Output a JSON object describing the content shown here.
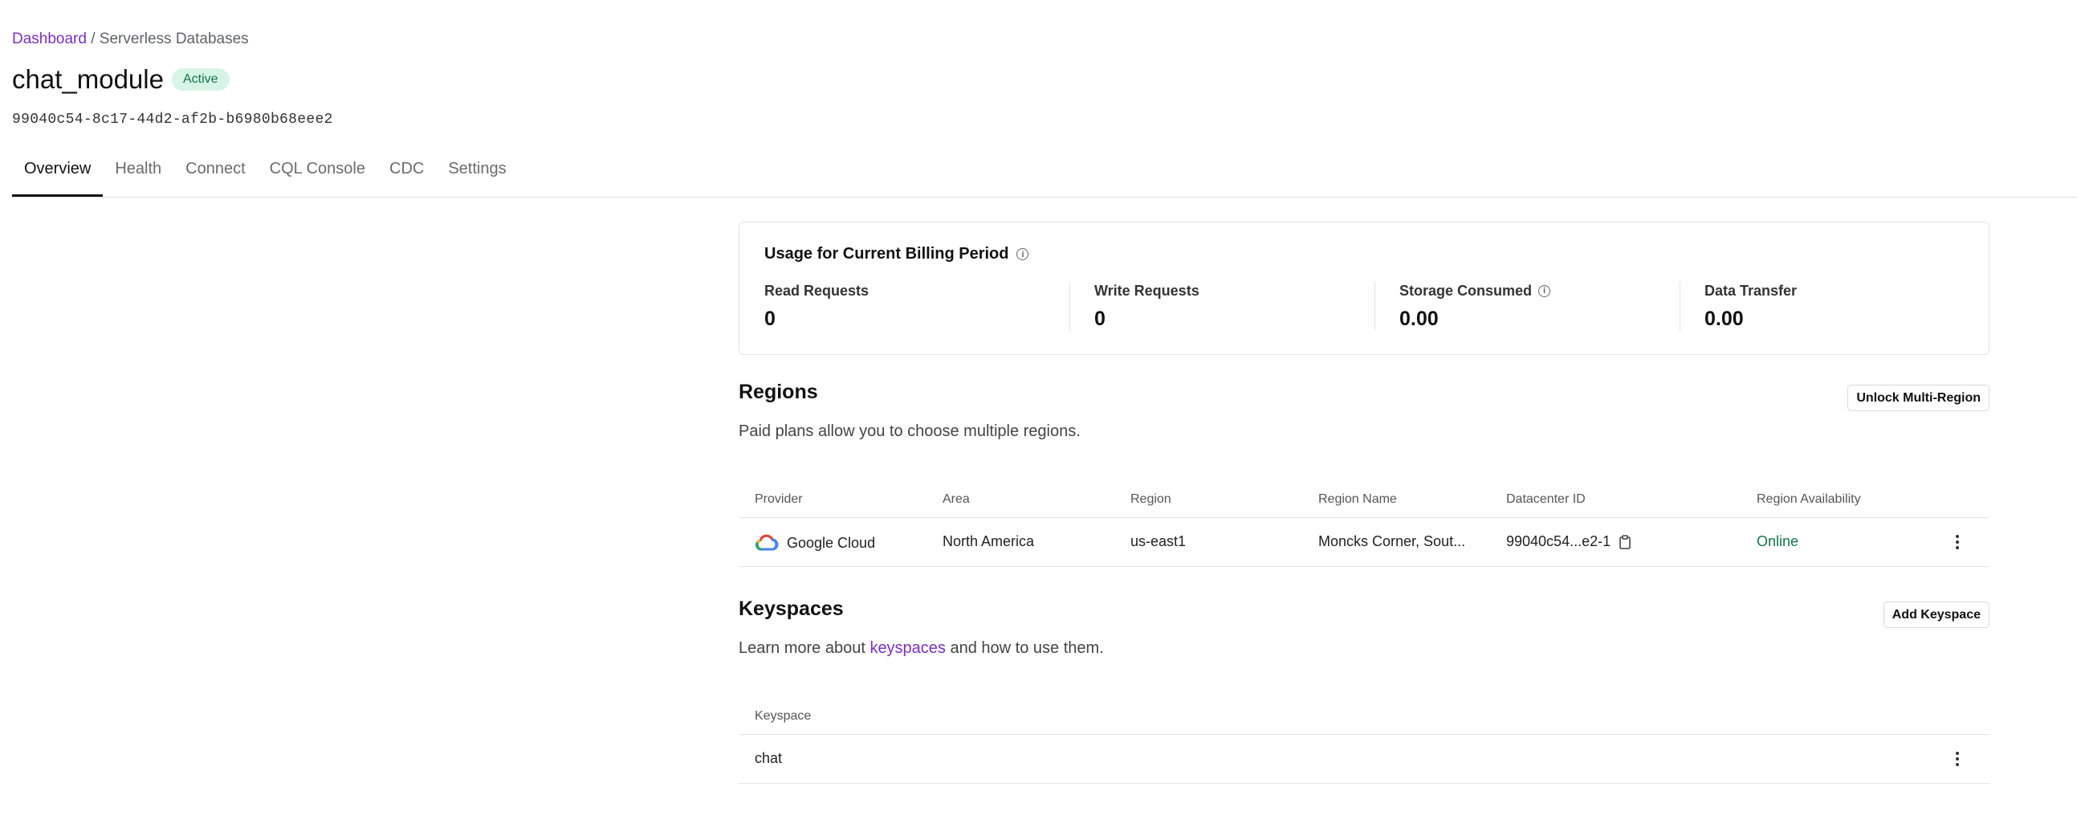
{
  "breadcrumb": {
    "root": "Dashboard",
    "separator": " / ",
    "current": "Serverless Databases"
  },
  "database": {
    "name": "chat_module",
    "status": "Active",
    "id": "99040c54-8c17-44d2-af2b-b6980b68eee2"
  },
  "tabs": [
    {
      "label": "Overview",
      "active": true
    },
    {
      "label": "Health"
    },
    {
      "label": "Connect"
    },
    {
      "label": "CQL Console"
    },
    {
      "label": "CDC"
    },
    {
      "label": "Settings"
    }
  ],
  "usage": {
    "title": "Usage for Current Billing Period",
    "metrics": [
      {
        "label": "Read Requests",
        "value": "0"
      },
      {
        "label": "Write Requests",
        "value": "0"
      },
      {
        "label": "Storage Consumed",
        "value": "0.00",
        "info": true
      },
      {
        "label": "Data Transfer",
        "value": "0.00"
      }
    ]
  },
  "regions": {
    "title": "Regions",
    "description": "Paid plans allow you to choose multiple regions.",
    "button": "Unlock Multi-Region",
    "columns": [
      "Provider",
      "Area",
      "Region",
      "Region Name",
      "Datacenter ID",
      "Region Availability"
    ],
    "rows": [
      {
        "provider": "Google Cloud",
        "provider_icon": "google-cloud-icon",
        "area": "North America",
        "region": "us-east1",
        "region_name": "Moncks Corner, Sout...",
        "datacenter_id": "99040c54...e2-1",
        "availability": "Online"
      }
    ]
  },
  "keyspaces": {
    "title": "Keyspaces",
    "description_prefix": "Learn more about ",
    "description_link": "keyspaces",
    "description_suffix": " and how to use them.",
    "button": "Add Keyspace",
    "columns": [
      "Keyspace"
    ],
    "rows": [
      {
        "name": "chat"
      }
    ]
  },
  "colors": {
    "accent": "#7b2fbf",
    "status_bg": "#d7f5e6",
    "status_text": "#13744a"
  }
}
